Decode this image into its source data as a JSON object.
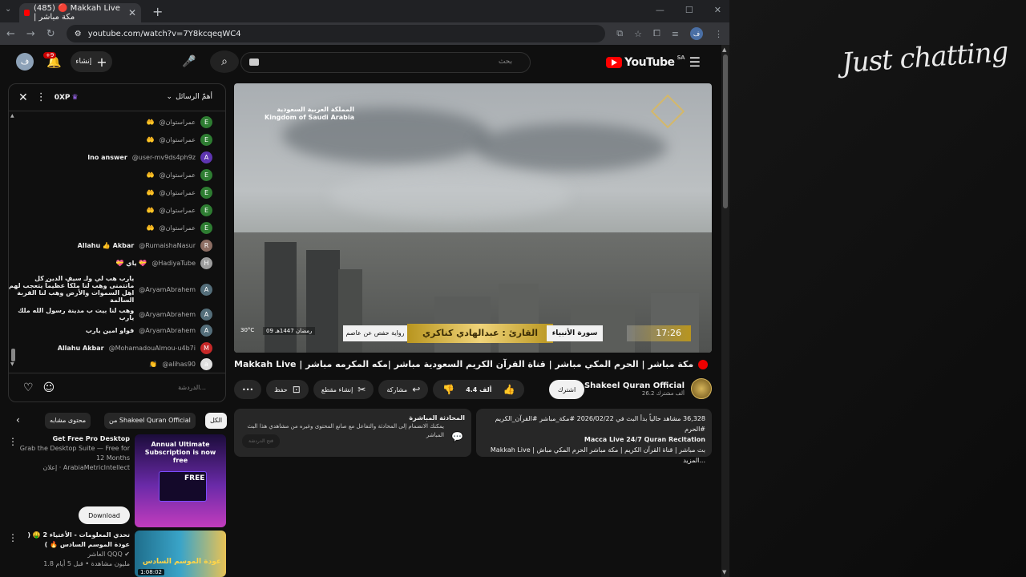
{
  "browser": {
    "tab_title": "(485) 🔴 Makkah Live | مكة مباشر",
    "url": "youtube.com/watch?v=7Y8kcqeqWC4"
  },
  "overlay": {
    "logo_text": "Just chatting"
  },
  "header": {
    "logo": "YouTube",
    "region": "SA",
    "search_placeholder": "بحث",
    "create_label": "إنشاء",
    "notifications_badge": "+9",
    "avatar_letter": "ف"
  },
  "chat": {
    "mode": "أهمّ الرسائل",
    "xp": "0XP",
    "input_placeholder": "الدردشة...",
    "messages": [
      {
        "author": "@عمراستوان",
        "text": "🤲",
        "av": "E",
        "color": "#2e7d32"
      },
      {
        "author": "@عمراستوان",
        "text": "🤲",
        "av": "E",
        "color": "#2e7d32"
      },
      {
        "author": "@user-mv9ds4ph9z",
        "text": "Ino answer",
        "av": "A",
        "color": "#5e35b1"
      },
      {
        "author": "@عمراستوان",
        "text": "🤲",
        "av": "E",
        "color": "#2e7d32"
      },
      {
        "author": "@عمراستوان",
        "text": "🤲",
        "av": "E",
        "color": "#2e7d32"
      },
      {
        "author": "@عمراستوان",
        "text": "🤲",
        "av": "E",
        "color": "#2e7d32"
      },
      {
        "author": "@عمراستوان",
        "text": "🤲",
        "av": "E",
        "color": "#2e7d32"
      },
      {
        "author": "@RumaishaNasur",
        "text": "Allahu 👍 Akbar",
        "av": "R",
        "color": "#8d6e63"
      },
      {
        "author": "@HadiyaTube",
        "text": "💝 ياي 💝",
        "av": "H",
        "color": "#9e9e9e"
      },
      {
        "author": "@AryamAbrahem",
        "text": "يارب هب لي ولـ سيف الدين كل ماتتمنى وهب لنا ملكاً عظيماً يتعجب لهم اهل السموات والأرض وهب لنا القربة السالمة",
        "av": "A",
        "color": "#546e7a"
      },
      {
        "author": "@AryamAbrahem",
        "text": "وهب لنا بيت ب مدينة رسول الله ملك يارب",
        "av": "A",
        "color": "#546e7a"
      },
      {
        "author": "@AryamAbrahem",
        "text": "فواو امين يارب",
        "av": "A",
        "color": "#546e7a"
      },
      {
        "author": "@MohamadouAlmou-u4b7i",
        "text": "Allahu Akbar",
        "av": "M",
        "color": "#c62828"
      },
      {
        "author": "@alihas90",
        "text": "👏",
        "av": "a",
        "color": "#e0e0e0"
      }
    ]
  },
  "video": {
    "banner_ar": "المملكة العربية السعودية",
    "banner_en": "Kingdom of Saudi Arabia",
    "reader": "القارئ : عبدالهادي كناكري",
    "surah": "سورة الأنبياء",
    "riwaya": "رواية حفص عن عاصم",
    "time": "17:26",
    "hijri": "09 رمضان 1447هـ",
    "temp": "30°C",
    "title": "مكة مباشر | الحرم المكي مباشر | قناة القرآن الكريم السعودية مباشر |مكه المكرمه مباشر | Makkah Live"
  },
  "channel": {
    "name": "Shakeel Quran Official",
    "subs": "26.2 ألف مشترك",
    "subscribe": "اشترك"
  },
  "actions": {
    "likes": "4.4 ألف",
    "share": "مشاركة",
    "clip": "إنشاء مقطع",
    "save": "حفظ",
    "more": "•••"
  },
  "description": {
    "line1": "36,328 مشاهد حالياً  بدأ البث في 2026/02/22  #مكة_مباشر #القرآن_الكريم #الحرم",
    "line2": "Macca Live 24/7 Quran Recitation",
    "line3": "بث مباشر | قناة القرآن الكريم | مكة مباشر الحرم المكي مباش | Makkah Live ...المزيد"
  },
  "live_chat_card": {
    "title": "المحادثة المباشرة",
    "body": "يمكنك الانضمام إلى المحادثة والتفاعل مع صانع المحتوى وغيره من مشاهدي هذا البث المباشر",
    "button": "فتح الدردشة"
  },
  "chips": {
    "all": "الكل",
    "from_channel": "من Shakeel Quran Official",
    "related": "محتوى مشابه"
  },
  "recommendations": [
    {
      "title": "Get Free Pro Desktop",
      "sub1": "Grab the Desktop Suite — Free for 12 Months",
      "sub2": "إعلان · ArabiaMetricIntellect",
      "thumb_title": "Annual Ultimate Subscription is now free",
      "thumb_badge": "FREE",
      "cta": "Download"
    },
    {
      "title": "تحدي المعلومات - الأعتياء 2 🤑 ( عودة الموسم السادس 🔥 )",
      "sub1": "العاشر QQQ ✔",
      "sub2": "1.8 مليون مشاهدة • قبل 5 أيام",
      "duration": "1:08:02",
      "thumb_title": "عودة الموسم السادس"
    }
  ]
}
